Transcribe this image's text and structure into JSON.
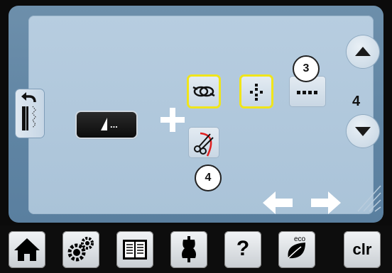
{
  "screen": {
    "back_icon": "return-arrow-icon",
    "stitch_display": {
      "label": "..."
    },
    "plus_icon": "plus-icon",
    "options": {
      "securing_icon": "knot-icon",
      "tie_off_icon": "dotted-cross-icon",
      "count_icon": "four-dots-icon",
      "cutter_icon": "scissors-icon"
    },
    "badges": {
      "count_badge": "3",
      "cutter_badge": "4"
    },
    "stepper": {
      "value": "4"
    }
  },
  "taskbar": {
    "clr_label": "clr",
    "eco_label": "eco",
    "help_label": "?"
  },
  "colors": {
    "screen_bg": "#5f84a3",
    "panel_bg": "#b7cde0",
    "highlight": "#f0e51a",
    "cut_line": "#e02020"
  }
}
